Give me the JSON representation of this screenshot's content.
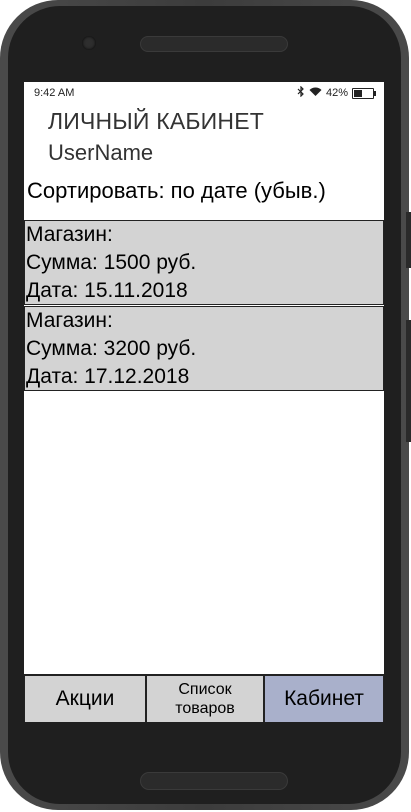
{
  "status_bar": {
    "time": "9:42 AM",
    "battery": "42%",
    "battery_level": 0.42
  },
  "header": {
    "title": "ЛИЧНЫЙ КАБИНЕТ",
    "username": "UserName"
  },
  "sort": {
    "label": "Сортировать: по дате (убыв.)"
  },
  "orders": [
    {
      "store": "Магазин:",
      "sum": "Сумма: 1500 руб.",
      "date": "Дата: 15.11.2018"
    },
    {
      "store": "Магазин:",
      "sum": "Сумма: 3200 руб.",
      "date": "Дата: 17.12.2018"
    }
  ],
  "tabs": {
    "promotions": "Акции",
    "products_line1": "Список",
    "products_line2": "товаров",
    "cabinet": "Кабинет"
  },
  "colors": {
    "card_bg": "#d3d3d3",
    "active_tab": "#a9b0cb"
  }
}
